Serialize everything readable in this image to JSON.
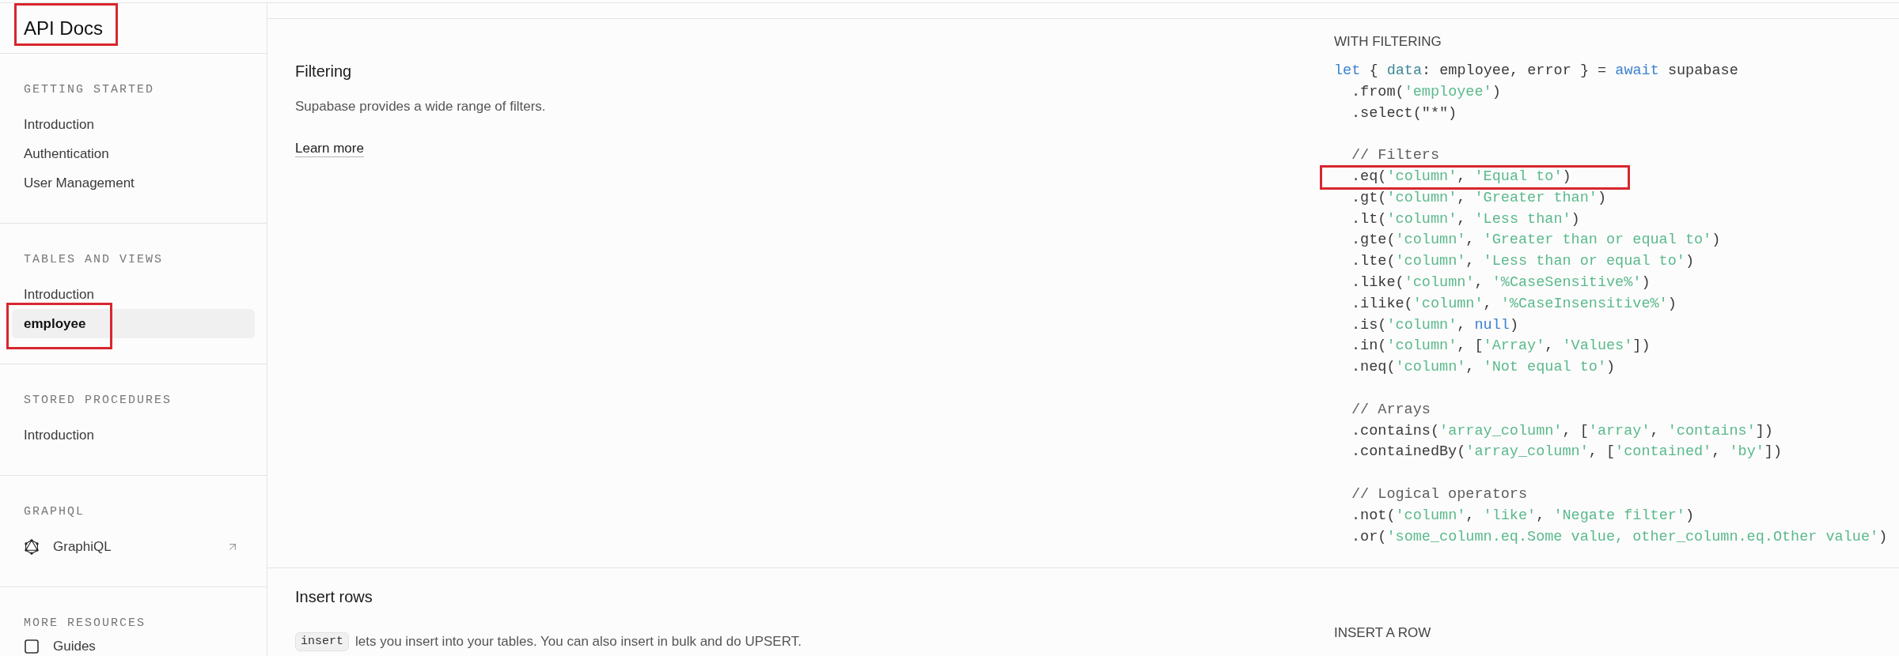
{
  "sidebar": {
    "title": {
      "text": "API Docs",
      "highlighted": true
    },
    "sections": [
      {
        "heading": "GETTING STARTED",
        "items": [
          {
            "label": "Introduction",
            "kind": "plain",
            "selected": false,
            "highlighted": false
          },
          {
            "label": "Authentication",
            "kind": "plain",
            "selected": false,
            "highlighted": false
          },
          {
            "label": "User Management",
            "kind": "plain",
            "selected": false,
            "highlighted": false
          }
        ]
      },
      {
        "heading": "TABLES AND VIEWS",
        "items": [
          {
            "label": "Introduction",
            "kind": "plain",
            "selected": false,
            "highlighted": false
          },
          {
            "label": "employee",
            "kind": "plain",
            "selected": true,
            "highlighted": true
          }
        ]
      },
      {
        "heading": "STORED PROCEDURES",
        "items": [
          {
            "label": "Introduction",
            "kind": "plain",
            "selected": false,
            "highlighted": false
          }
        ]
      },
      {
        "heading": "GRAPHQL",
        "items": [
          {
            "label": "GraphiQL",
            "kind": "external",
            "selected": false,
            "highlighted": false
          }
        ]
      },
      {
        "heading": "MORE RESOURCES",
        "items": [
          {
            "label": "Guides",
            "kind": "resource",
            "selected": false,
            "highlighted": false
          }
        ]
      }
    ]
  },
  "content": [
    {
      "title": "Filtering",
      "description": "Supabase provides a wide range of filters.",
      "link": "Learn more",
      "example": {
        "label": "WITH FILTERING",
        "head": [
          {
            "kind": "keyword",
            "text": "let"
          },
          {
            "kind": "plain",
            "text": " { "
          },
          {
            "kind": "property",
            "text": "data"
          },
          {
            "kind": "plain",
            "text": ": employee, error } = "
          },
          {
            "kind": "keyword",
            "text": "await"
          },
          {
            "kind": "plain",
            "text": " supabase"
          }
        ],
        "chain": [
          {
            "kind": "code",
            "highlighted": false,
            "tokens": [
              {
                "kind": "plain",
                "text": ".from("
              },
              {
                "kind": "string",
                "text": "'employee'"
              },
              {
                "kind": "plain",
                "text": ")"
              }
            ]
          },
          {
            "kind": "code",
            "highlighted": false,
            "tokens": [
              {
                "kind": "plain",
                "text": ".select(\"*\")"
              }
            ]
          },
          {
            "kind": "blank"
          },
          {
            "kind": "code",
            "highlighted": false,
            "tokens": [
              {
                "kind": "comment",
                "text": "// Filters"
              }
            ]
          },
          {
            "kind": "code",
            "highlighted": true,
            "tokens": [
              {
                "kind": "plain",
                "text": ".eq("
              },
              {
                "kind": "string",
                "text": "'column'"
              },
              {
                "kind": "plain",
                "text": ", "
              },
              {
                "kind": "string",
                "text": "'Equal to'"
              },
              {
                "kind": "plain",
                "text": ")"
              }
            ]
          },
          {
            "kind": "code",
            "highlighted": false,
            "tokens": [
              {
                "kind": "plain",
                "text": ".gt("
              },
              {
                "kind": "string",
                "text": "'column'"
              },
              {
                "kind": "plain",
                "text": ", "
              },
              {
                "kind": "string",
                "text": "'Greater than'"
              },
              {
                "kind": "plain",
                "text": ")"
              }
            ]
          },
          {
            "kind": "code",
            "highlighted": false,
            "tokens": [
              {
                "kind": "plain",
                "text": ".lt("
              },
              {
                "kind": "string",
                "text": "'column'"
              },
              {
                "kind": "plain",
                "text": ", "
              },
              {
                "kind": "string",
                "text": "'Less than'"
              },
              {
                "kind": "plain",
                "text": ")"
              }
            ]
          },
          {
            "kind": "code",
            "highlighted": false,
            "tokens": [
              {
                "kind": "plain",
                "text": ".gte("
              },
              {
                "kind": "string",
                "text": "'column'"
              },
              {
                "kind": "plain",
                "text": ", "
              },
              {
                "kind": "string",
                "text": "'Greater than or equal to'"
              },
              {
                "kind": "plain",
                "text": ")"
              }
            ]
          },
          {
            "kind": "code",
            "highlighted": false,
            "tokens": [
              {
                "kind": "plain",
                "text": ".lte("
              },
              {
                "kind": "string",
                "text": "'column'"
              },
              {
                "kind": "plain",
                "text": ", "
              },
              {
                "kind": "string",
                "text": "'Less than or equal to'"
              },
              {
                "kind": "plain",
                "text": ")"
              }
            ]
          },
          {
            "kind": "code",
            "highlighted": false,
            "tokens": [
              {
                "kind": "plain",
                "text": ".like("
              },
              {
                "kind": "string",
                "text": "'column'"
              },
              {
                "kind": "plain",
                "text": ", "
              },
              {
                "kind": "string",
                "text": "'%CaseSensitive%'"
              },
              {
                "kind": "plain",
                "text": ")"
              }
            ]
          },
          {
            "kind": "code",
            "highlighted": false,
            "tokens": [
              {
                "kind": "plain",
                "text": ".ilike("
              },
              {
                "kind": "string",
                "text": "'column'"
              },
              {
                "kind": "plain",
                "text": ", "
              },
              {
                "kind": "string",
                "text": "'%CaseInsensitive%'"
              },
              {
                "kind": "plain",
                "text": ")"
              }
            ]
          },
          {
            "kind": "code",
            "highlighted": false,
            "tokens": [
              {
                "kind": "plain",
                "text": ".is("
              },
              {
                "kind": "string",
                "text": "'column'"
              },
              {
                "kind": "plain",
                "text": ", "
              },
              {
                "kind": "keyword",
                "text": "null"
              },
              {
                "kind": "plain",
                "text": ")"
              }
            ]
          },
          {
            "kind": "code",
            "highlighted": false,
            "tokens": [
              {
                "kind": "plain",
                "text": ".in("
              },
              {
                "kind": "string",
                "text": "'column'"
              },
              {
                "kind": "plain",
                "text": ", ["
              },
              {
                "kind": "string",
                "text": "'Array'"
              },
              {
                "kind": "plain",
                "text": ", "
              },
              {
                "kind": "string",
                "text": "'Values'"
              },
              {
                "kind": "plain",
                "text": "])"
              }
            ]
          },
          {
            "kind": "code",
            "highlighted": false,
            "tokens": [
              {
                "kind": "plain",
                "text": ".neq("
              },
              {
                "kind": "string",
                "text": "'column'"
              },
              {
                "kind": "plain",
                "text": ", "
              },
              {
                "kind": "string",
                "text": "'Not equal to'"
              },
              {
                "kind": "plain",
                "text": ")"
              }
            ]
          },
          {
            "kind": "blank"
          },
          {
            "kind": "code",
            "highlighted": false,
            "tokens": [
              {
                "kind": "comment",
                "text": "// Arrays"
              }
            ]
          },
          {
            "kind": "code",
            "highlighted": false,
            "tokens": [
              {
                "kind": "plain",
                "text": ".contains("
              },
              {
                "kind": "string",
                "text": "'array_column'"
              },
              {
                "kind": "plain",
                "text": ", ["
              },
              {
                "kind": "string",
                "text": "'array'"
              },
              {
                "kind": "plain",
                "text": ", "
              },
              {
                "kind": "string",
                "text": "'contains'"
              },
              {
                "kind": "plain",
                "text": "])"
              }
            ]
          },
          {
            "kind": "code",
            "highlighted": false,
            "tokens": [
              {
                "kind": "plain",
                "text": ".containedBy("
              },
              {
                "kind": "string",
                "text": "'array_column'"
              },
              {
                "kind": "plain",
                "text": ", ["
              },
              {
                "kind": "string",
                "text": "'contained'"
              },
              {
                "kind": "plain",
                "text": ", "
              },
              {
                "kind": "string",
                "text": "'by'"
              },
              {
                "kind": "plain",
                "text": "])"
              }
            ]
          },
          {
            "kind": "blank"
          },
          {
            "kind": "code",
            "highlighted": false,
            "tokens": [
              {
                "kind": "comment",
                "text": "// Logical operators"
              }
            ]
          },
          {
            "kind": "code",
            "highlighted": false,
            "tokens": [
              {
                "kind": "plain",
                "text": ".not("
              },
              {
                "kind": "string",
                "text": "'column'"
              },
              {
                "kind": "plain",
                "text": ", "
              },
              {
                "kind": "string",
                "text": "'like'"
              },
              {
                "kind": "plain",
                "text": ", "
              },
              {
                "kind": "string",
                "text": "'Negate filter'"
              },
              {
                "kind": "plain",
                "text": ")"
              }
            ]
          },
          {
            "kind": "code",
            "highlighted": false,
            "tokens": [
              {
                "kind": "plain",
                "text": ".or("
              },
              {
                "kind": "string",
                "text": "'some_column.eq.Some value, other_column.eq.Other value'"
              },
              {
                "kind": "plain",
                "text": ")"
              }
            ]
          }
        ]
      }
    },
    {
      "title": "Insert rows",
      "description_code": "insert",
      "description": "lets you insert into your tables. You can also insert in bulk and do UPSERT.",
      "example": {
        "label": "INSERT A ROW"
      }
    }
  ]
}
